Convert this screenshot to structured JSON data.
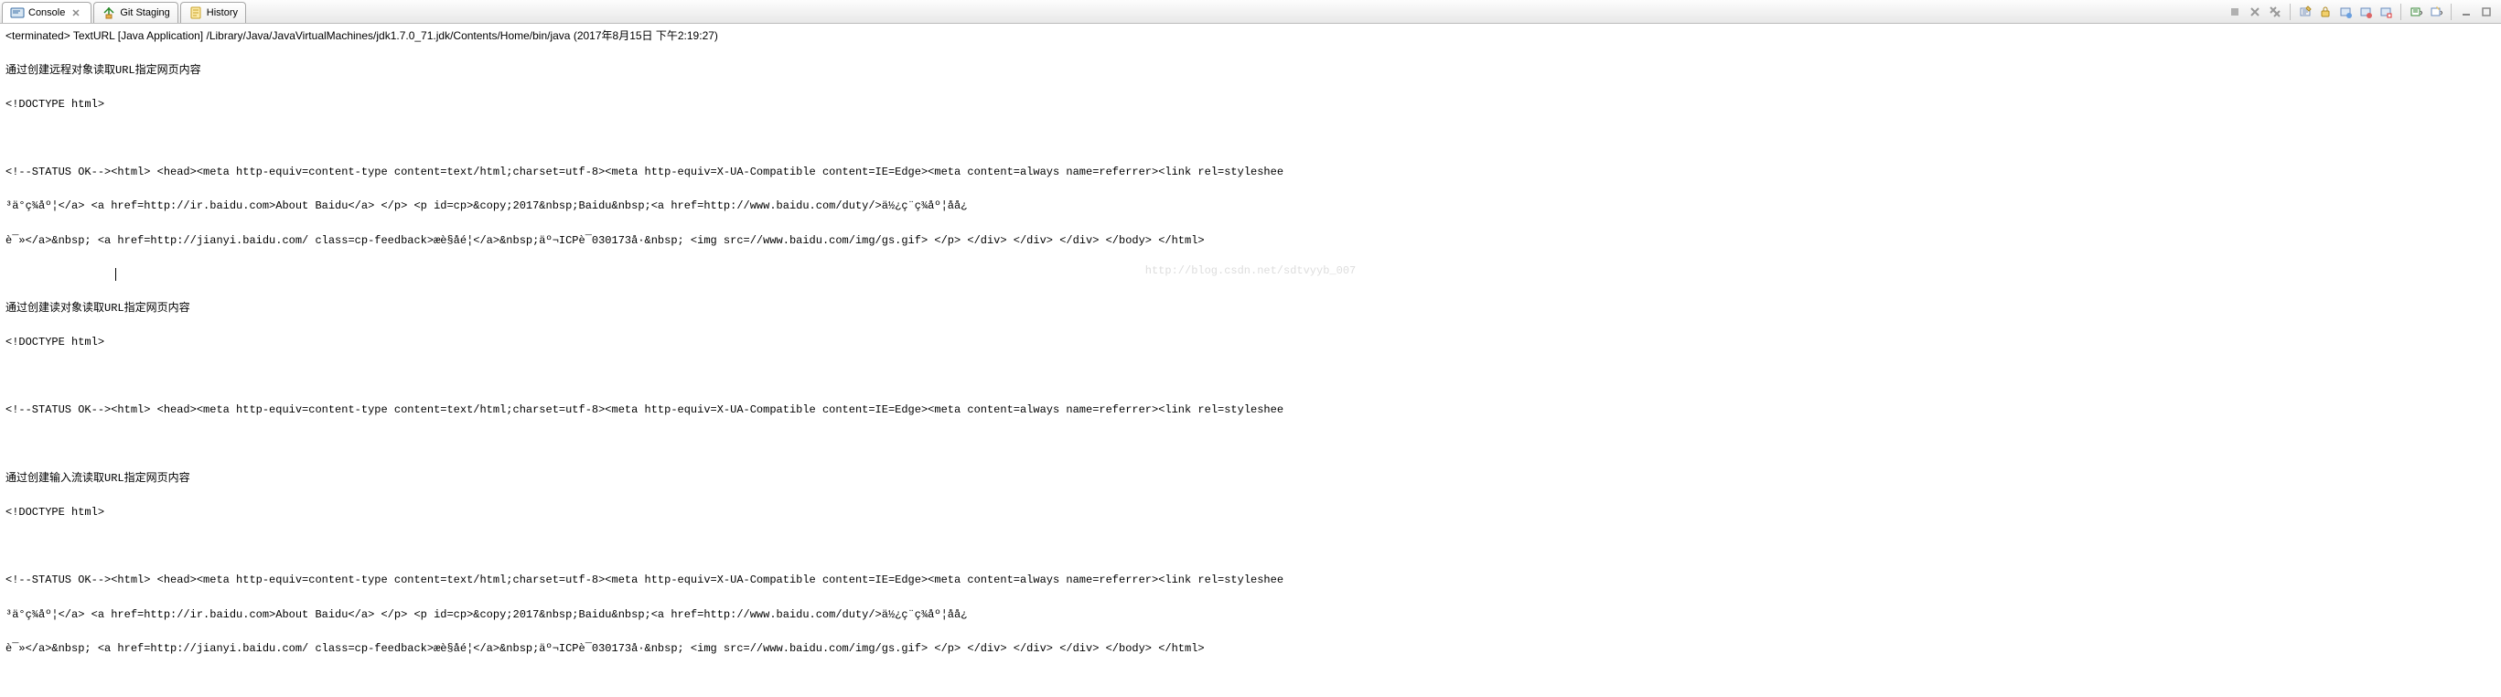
{
  "tabs": {
    "console": {
      "label": "Console"
    },
    "git_staging": {
      "label": "Git Staging"
    },
    "history": {
      "label": "History"
    }
  },
  "status": {
    "terminated_prefix": "<terminated>",
    "program": "TextURL [Java Application]",
    "path": "/Library/Java/JavaVirtualMachines/jdk1.7.0_71.jdk/Contents/Home/bin/java",
    "timestamp": "(2017年8月15日 下午2:19:27)"
  },
  "output": {
    "block1_title": "通过创建远程对象读取URL指定网页内容",
    "doctype": "<!DOCTYPE html>",
    "status_ok_line": "<!--STATUS OK--><html> <head><meta http-equiv=content-type content=text/html;charset=utf-8><meta http-equiv=X-UA-Compatible content=IE=Edge><meta content=always name=referrer><link rel=styleshee",
    "midline1": "³ä°ç¾åº¦</a> <a href=http://ir.baidu.com>About Baidu</a> </p> <p id=cp>&copy;2017&nbsp;Baidu&nbsp;<a href=http://www.baidu.com/duty/>ä½¿ç¨ç¾åº¦åå¿",
    "midline2": "è¯»</a>&nbsp; <a href=http://jianyi.baidu.com/ class=cp-feedback>æè§åé¦</a>&nbsp;äº¬ICPè¯030173å·&nbsp; <img src=//www.baidu.com/img/gs.gif> </p> </div> </div> </div> </body> </html>",
    "block2_title": "通过创建读对象读取URL指定网页内容",
    "block3_title": "通过创建输入流读取URL指定网页内容",
    "watermark": "http://blog.csdn.net/sdtvyyb_007"
  },
  "toolbar": {
    "close_console": "close-console",
    "remove_all_terminated": "remove-all-terminated",
    "clear_console": "clear-console",
    "scroll_lock": "scroll-lock",
    "word_wrap": "word-wrap",
    "pin_console": "pin-console",
    "display_selected": "display-selected",
    "open_console": "open-console",
    "new_console": "new-console",
    "minimize": "minimize",
    "maximize": "maximize"
  }
}
